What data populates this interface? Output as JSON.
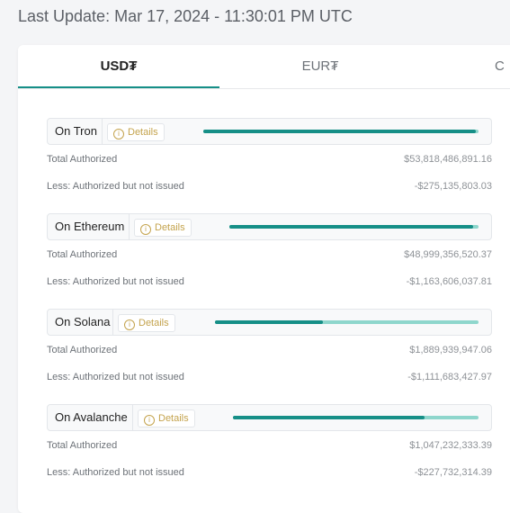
{
  "last_update": "Last Update: Mar 17, 2024 - 11:30:01 PM UTC",
  "tabs": [
    {
      "label": "USD₮",
      "active": true
    },
    {
      "label": "EUR₮",
      "active": false
    },
    {
      "label": "C",
      "active": false
    }
  ],
  "colors": {
    "accent": "#168f87",
    "accent_light": "#8ed6cc",
    "details": "#c4a34d"
  },
  "details_label": "Details",
  "chains": [
    {
      "name": "On Tron",
      "total_label": "Total Authorized",
      "total_value": "$53,818,486,891.16",
      "less_label": "Less: Authorized but not issued",
      "less_value": "-$275,135,803.03",
      "issued_fraction": 0.99
    },
    {
      "name": "On Ethereum",
      "total_label": "Total Authorized",
      "total_value": "$48,999,356,520.37",
      "less_label": "Less: Authorized but not issued",
      "less_value": "-$1,163,606,037.81",
      "issued_fraction": 0.98
    },
    {
      "name": "On Solana",
      "total_label": "Total Authorized",
      "total_value": "$1,889,939,947.06",
      "less_label": "Less: Authorized but not issued",
      "less_value": "-$1,111,683,427.97",
      "issued_fraction": 0.41
    },
    {
      "name": "On Avalanche",
      "total_label": "Total Authorized",
      "total_value": "$1,047,232,333.39",
      "less_label": "Less: Authorized but not issued",
      "less_value": "-$227,732,314.39",
      "issued_fraction": 0.78
    }
  ]
}
